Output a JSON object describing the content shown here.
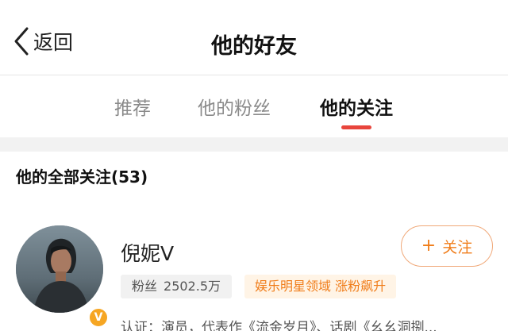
{
  "header": {
    "back_label": "返回",
    "title": "他的好友"
  },
  "tabs": [
    {
      "label": "推荐",
      "active": false
    },
    {
      "label": "他的粉丝",
      "active": false
    },
    {
      "label": "他的关注",
      "active": true
    }
  ],
  "section": {
    "title": "他的全部关注(53)"
  },
  "users": [
    {
      "name": "倪妮V",
      "fans_label": "粉丝",
      "fans_count": "2502.5万",
      "tag": "娱乐明星领域 涨粉飙升",
      "verification": "认证：演员，代表作《流金岁月》、话剧《幺幺洞捌...",
      "follow_label": "关注",
      "follow_icon": "plus-icon",
      "verified_badge": "V"
    }
  ],
  "colors": {
    "accent_red": "#e8453c",
    "accent_orange": "#f07d1a",
    "tag_bg": "#fff4e6",
    "verified_gold": "#f6a623"
  }
}
